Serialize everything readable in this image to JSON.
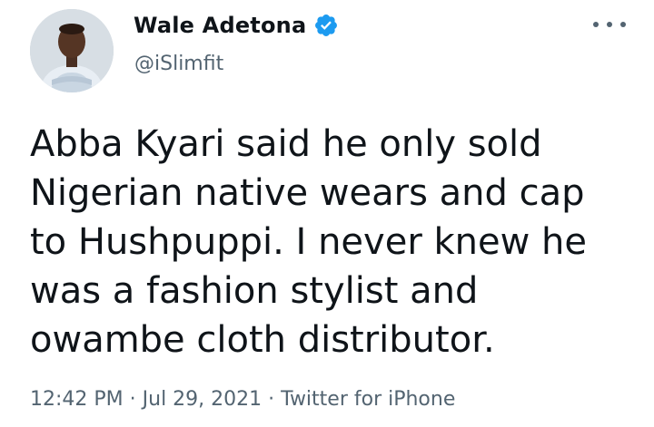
{
  "author": {
    "display_name": "Wale Adetona",
    "handle": "@iSlimfit",
    "verified": true
  },
  "tweet": {
    "lines": [
      "Abba Kyari said he only sold",
      "Nigerian native wears and cap",
      "to Hushpuppi. I never knew he",
      "was a fashion stylist and",
      "owambe cloth distributor."
    ]
  },
  "meta": {
    "time": "12:42 PM",
    "separator1": " · ",
    "date": "Jul 29, 2021",
    "separator2": " · ",
    "source": "Twitter for iPhone"
  },
  "colors": {
    "verified_badge": "#1d9bf0",
    "secondary_text": "#536471",
    "primary_text": "#0f1419"
  },
  "icons": {
    "verified": "verified-badge-icon",
    "more": "more-options-icon"
  }
}
